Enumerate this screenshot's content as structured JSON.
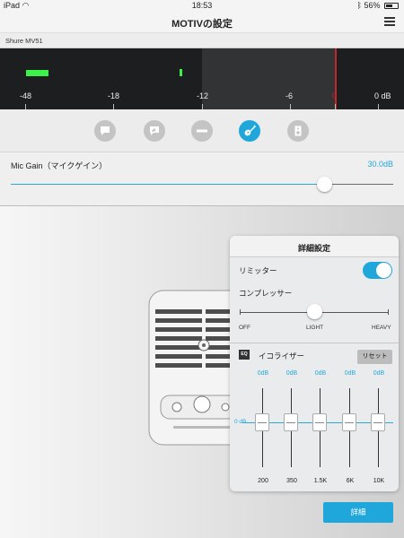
{
  "status_bar": {
    "device": "iPad",
    "time": "18:53",
    "battery": "56%"
  },
  "nav": {
    "title": "MOTIVの設定"
  },
  "device": {
    "name": "Shure MV51"
  },
  "meter": {
    "ticks": [
      "-48",
      "-18",
      "-12",
      "-6",
      "0",
      "0 dB"
    ],
    "level_left": "-48",
    "level_right": "-12"
  },
  "presets": [
    {
      "icon": "speech-bubble-icon",
      "active": false
    },
    {
      "icon": "music-note-bubble-icon",
      "active": false
    },
    {
      "icon": "flat-mode-icon",
      "active": false
    },
    {
      "icon": "guitar-icon",
      "active": true
    },
    {
      "icon": "speaker-icon",
      "active": false
    }
  ],
  "gain": {
    "label": "Mic Gain（マイクゲイン）",
    "value": "30.0dB",
    "level": 0.82
  },
  "panel": {
    "title": "詳細設定",
    "limiter_label": "リミッター",
    "limiter_on": true,
    "compressor_label": "コンプレッサー",
    "compressor_options": [
      "OFF",
      "LIGHT",
      "HEAVY"
    ],
    "compressor_selected": "LIGHT",
    "eq_badge": "EQ",
    "eq_label": "イコライザー",
    "reset_label": "リセット",
    "eq_zero_label": "0 dB",
    "bands": [
      {
        "value": "0dB",
        "freq": "200"
      },
      {
        "value": "0dB",
        "freq": "350"
      },
      {
        "value": "0dB",
        "freq": "1.5K"
      },
      {
        "value": "0dB",
        "freq": "6K"
      },
      {
        "value": "0dB",
        "freq": "10K"
      }
    ]
  },
  "details_button": "詳細",
  "colors": {
    "accent": "#1fa7dc",
    "meter_green": "#3cf24a",
    "meter_red": "#c3272b"
  }
}
